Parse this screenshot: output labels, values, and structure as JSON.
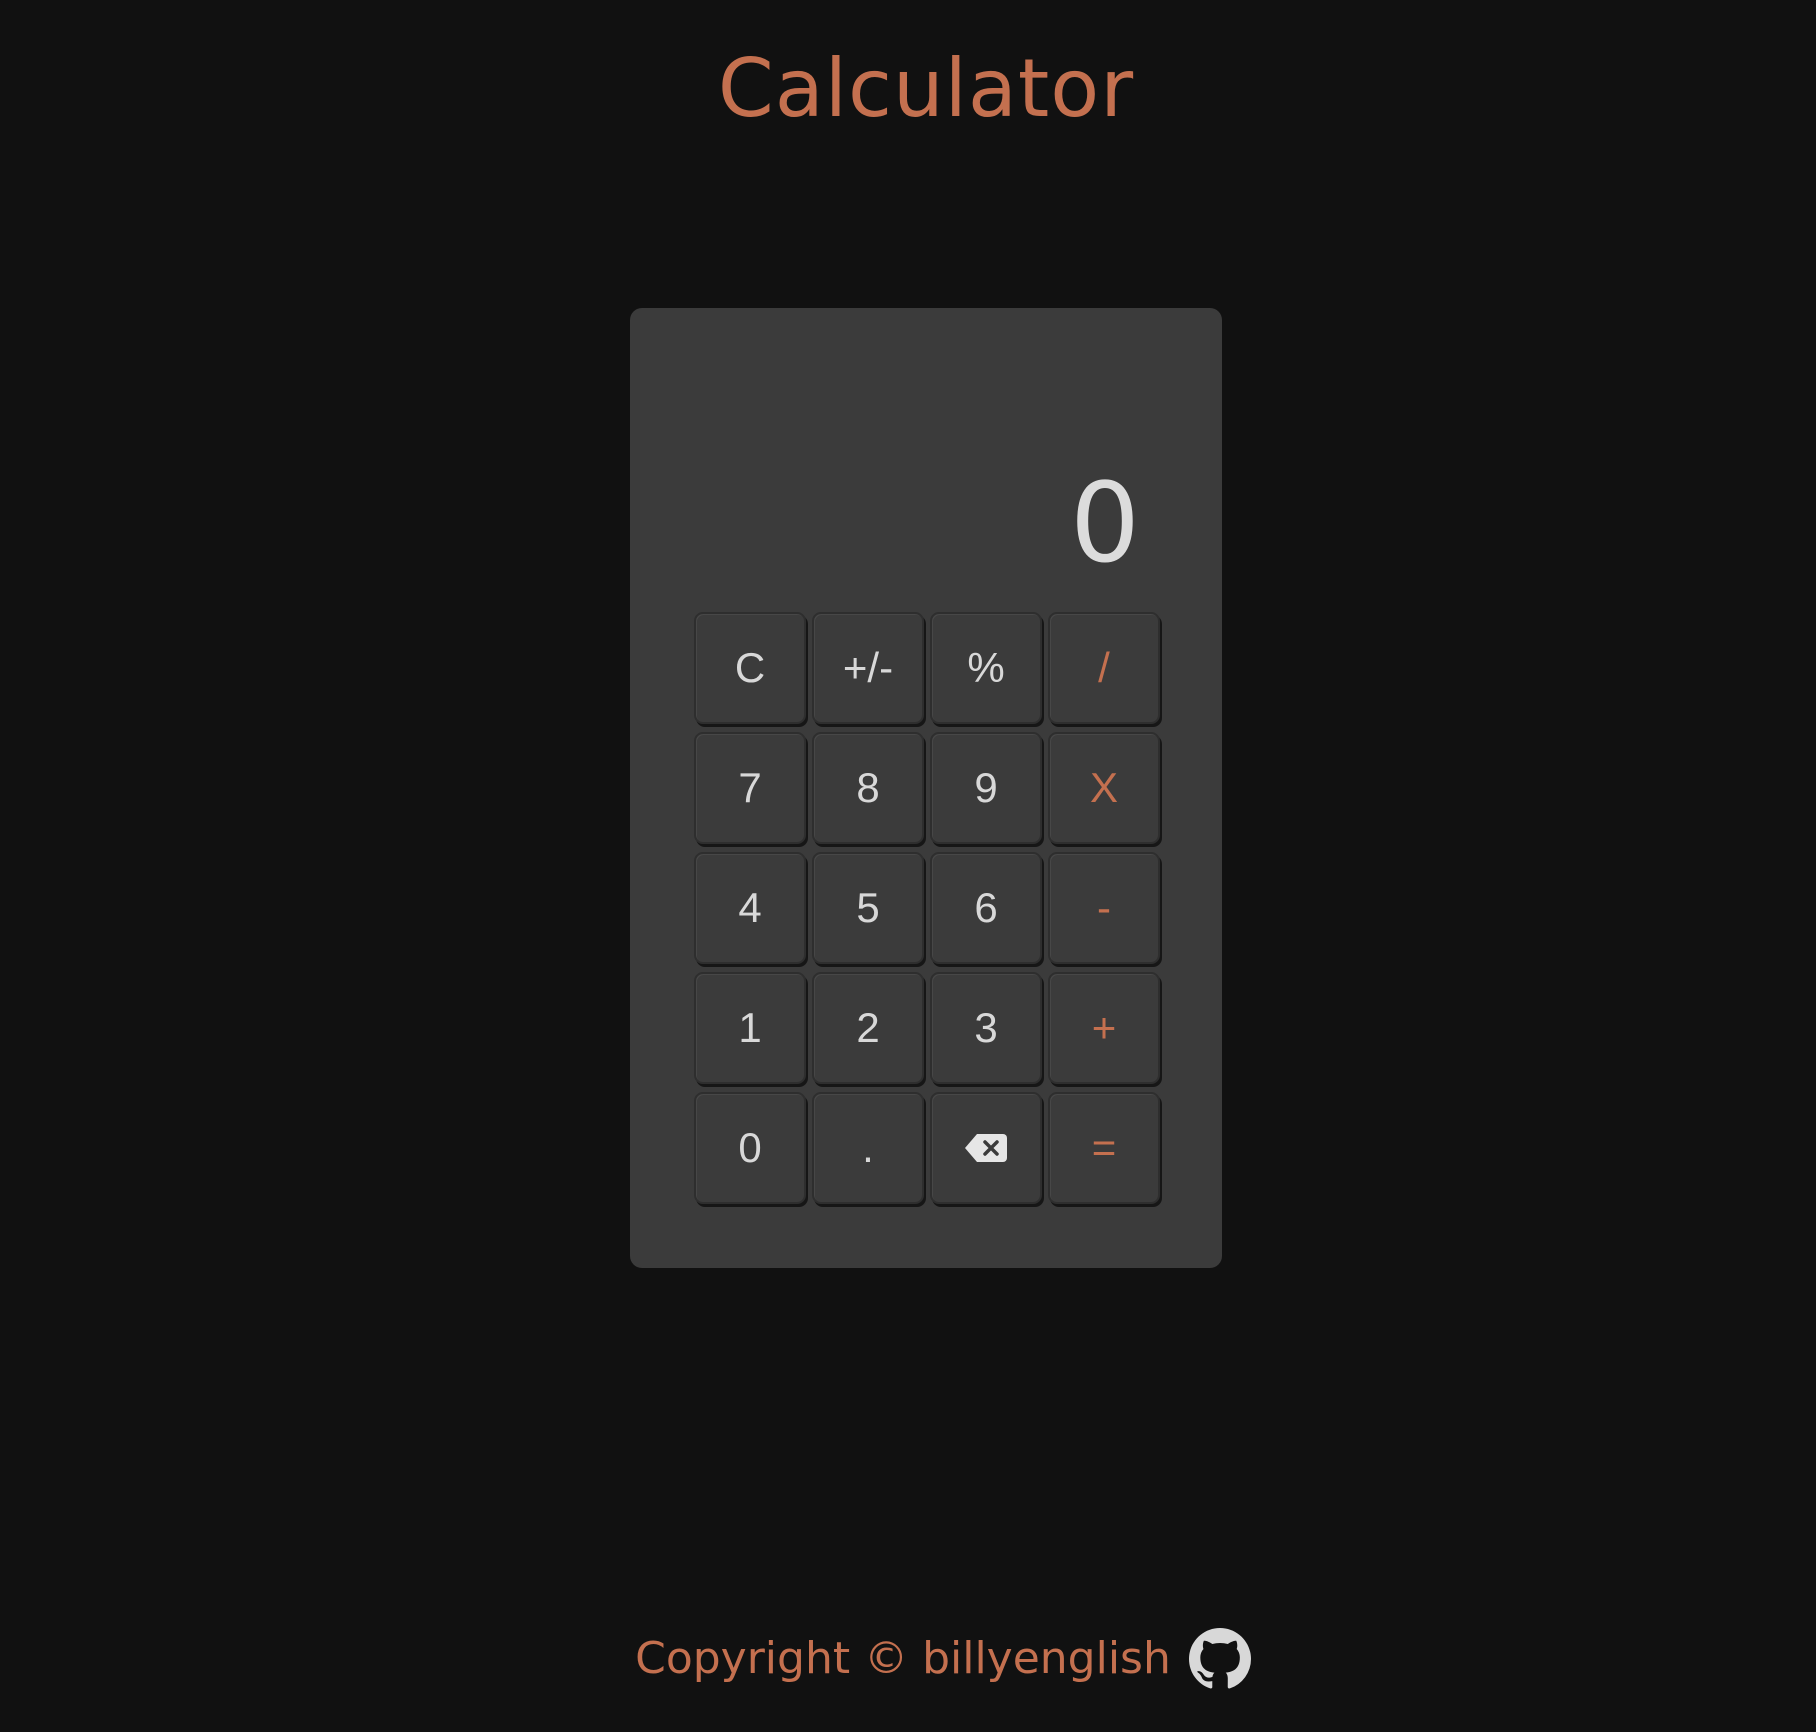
{
  "header": {
    "title": "Calculator"
  },
  "calculator": {
    "display_value": "0",
    "keys": [
      {
        "label": "C",
        "type": "function",
        "name": "clear-button"
      },
      {
        "label": "+/-",
        "type": "function",
        "name": "negate-button"
      },
      {
        "label": "%",
        "type": "function",
        "name": "percent-button"
      },
      {
        "label": "/",
        "type": "operator",
        "name": "divide-button"
      },
      {
        "label": "7",
        "type": "digit",
        "name": "digit-7-button"
      },
      {
        "label": "8",
        "type": "digit",
        "name": "digit-8-button"
      },
      {
        "label": "9",
        "type": "digit",
        "name": "digit-9-button"
      },
      {
        "label": "X",
        "type": "operator",
        "name": "multiply-button"
      },
      {
        "label": "4",
        "type": "digit",
        "name": "digit-4-button"
      },
      {
        "label": "5",
        "type": "digit",
        "name": "digit-5-button"
      },
      {
        "label": "6",
        "type": "digit",
        "name": "digit-6-button"
      },
      {
        "label": "-",
        "type": "operator",
        "name": "subtract-button"
      },
      {
        "label": "1",
        "type": "digit",
        "name": "digit-1-button"
      },
      {
        "label": "2",
        "type": "digit",
        "name": "digit-2-button"
      },
      {
        "label": "3",
        "type": "digit",
        "name": "digit-3-button"
      },
      {
        "label": "+",
        "type": "operator",
        "name": "add-button"
      },
      {
        "label": "0",
        "type": "digit",
        "name": "digit-0-button"
      },
      {
        "label": ".",
        "type": "digit",
        "name": "decimal-button"
      },
      {
        "label": "",
        "type": "icon",
        "icon": "backspace-icon",
        "name": "backspace-button"
      },
      {
        "label": "=",
        "type": "operator",
        "name": "equals-button"
      }
    ]
  },
  "footer": {
    "text": "Copyright © billyenglish",
    "icon": "github-icon"
  },
  "colors": {
    "background": "#111111",
    "panel": "#3b3b3b",
    "accent": "#c4704f",
    "text": "#d8d8d8"
  }
}
